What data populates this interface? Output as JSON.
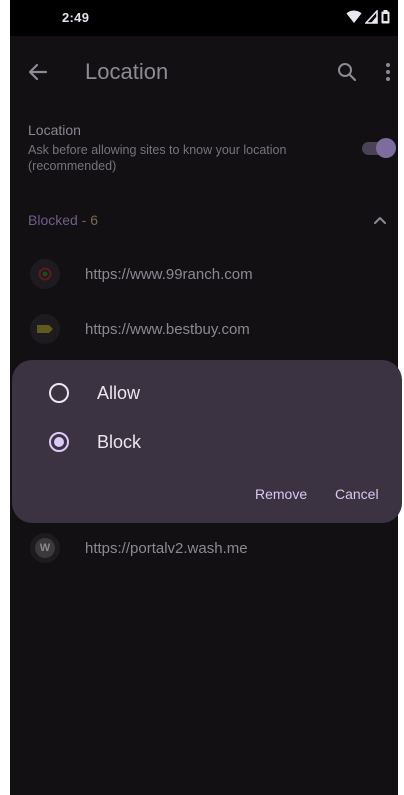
{
  "status_bar": {
    "time": "2:49",
    "icons": [
      "wifi-icon",
      "signal-icon",
      "battery-icon"
    ]
  },
  "app_bar": {
    "title": "Location",
    "back_icon": "arrow-back-icon",
    "search_icon": "search-icon",
    "more_icon": "more-vert-icon"
  },
  "setting": {
    "title": "Location",
    "subtitle": "Ask before allowing sites to know your location (recommended)",
    "enabled": true
  },
  "blocked_section": {
    "label": "Blocked",
    "count": " - 6",
    "expanded": true
  },
  "sites": [
    {
      "url": "https://www.99ranch.com",
      "icon": "ranch-favicon"
    },
    {
      "url": "https://www.bestbuy.com",
      "icon": "bestbuy-favicon"
    },
    {
      "url": "https://portalv2.wash.me",
      "icon": "wash-favicon",
      "icon_letter": "W"
    }
  ],
  "dialog": {
    "options": [
      {
        "label": "Allow",
        "checked": false
      },
      {
        "label": "Block",
        "checked": true
      }
    ],
    "remove_label": "Remove",
    "cancel_label": "Cancel"
  },
  "colors": {
    "accent": "#d9cbf6",
    "dialog_bg": "#3b3341",
    "background": "#000000"
  }
}
